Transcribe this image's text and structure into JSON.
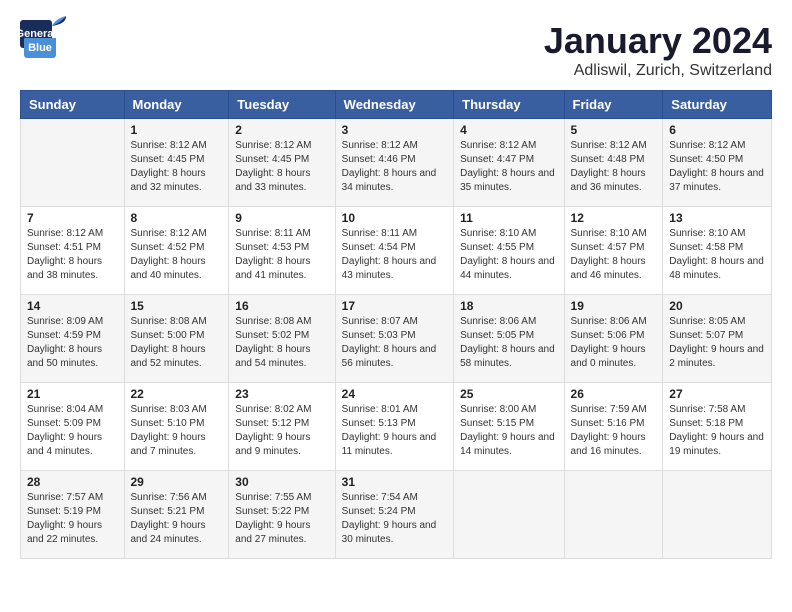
{
  "logo": {
    "general": "General",
    "blue": "Blue"
  },
  "title": "January 2024",
  "location": "Adliswil, Zurich, Switzerland",
  "days_of_week": [
    "Sunday",
    "Monday",
    "Tuesday",
    "Wednesday",
    "Thursday",
    "Friday",
    "Saturday"
  ],
  "weeks": [
    [
      {
        "day": "",
        "sunrise": "",
        "sunset": "",
        "daylight": ""
      },
      {
        "day": "1",
        "sunrise": "Sunrise: 8:12 AM",
        "sunset": "Sunset: 4:45 PM",
        "daylight": "Daylight: 8 hours and 32 minutes."
      },
      {
        "day": "2",
        "sunrise": "Sunrise: 8:12 AM",
        "sunset": "Sunset: 4:45 PM",
        "daylight": "Daylight: 8 hours and 33 minutes."
      },
      {
        "day": "3",
        "sunrise": "Sunrise: 8:12 AM",
        "sunset": "Sunset: 4:46 PM",
        "daylight": "Daylight: 8 hours and 34 minutes."
      },
      {
        "day": "4",
        "sunrise": "Sunrise: 8:12 AM",
        "sunset": "Sunset: 4:47 PM",
        "daylight": "Daylight: 8 hours and 35 minutes."
      },
      {
        "day": "5",
        "sunrise": "Sunrise: 8:12 AM",
        "sunset": "Sunset: 4:48 PM",
        "daylight": "Daylight: 8 hours and 36 minutes."
      },
      {
        "day": "6",
        "sunrise": "Sunrise: 8:12 AM",
        "sunset": "Sunset: 4:50 PM",
        "daylight": "Daylight: 8 hours and 37 minutes."
      }
    ],
    [
      {
        "day": "7",
        "sunrise": "Sunrise: 8:12 AM",
        "sunset": "Sunset: 4:51 PM",
        "daylight": "Daylight: 8 hours and 38 minutes."
      },
      {
        "day": "8",
        "sunrise": "Sunrise: 8:12 AM",
        "sunset": "Sunset: 4:52 PM",
        "daylight": "Daylight: 8 hours and 40 minutes."
      },
      {
        "day": "9",
        "sunrise": "Sunrise: 8:11 AM",
        "sunset": "Sunset: 4:53 PM",
        "daylight": "Daylight: 8 hours and 41 minutes."
      },
      {
        "day": "10",
        "sunrise": "Sunrise: 8:11 AM",
        "sunset": "Sunset: 4:54 PM",
        "daylight": "Daylight: 8 hours and 43 minutes."
      },
      {
        "day": "11",
        "sunrise": "Sunrise: 8:10 AM",
        "sunset": "Sunset: 4:55 PM",
        "daylight": "Daylight: 8 hours and 44 minutes."
      },
      {
        "day": "12",
        "sunrise": "Sunrise: 8:10 AM",
        "sunset": "Sunset: 4:57 PM",
        "daylight": "Daylight: 8 hours and 46 minutes."
      },
      {
        "day": "13",
        "sunrise": "Sunrise: 8:10 AM",
        "sunset": "Sunset: 4:58 PM",
        "daylight": "Daylight: 8 hours and 48 minutes."
      }
    ],
    [
      {
        "day": "14",
        "sunrise": "Sunrise: 8:09 AM",
        "sunset": "Sunset: 4:59 PM",
        "daylight": "Daylight: 8 hours and 50 minutes."
      },
      {
        "day": "15",
        "sunrise": "Sunrise: 8:08 AM",
        "sunset": "Sunset: 5:00 PM",
        "daylight": "Daylight: 8 hours and 52 minutes."
      },
      {
        "day": "16",
        "sunrise": "Sunrise: 8:08 AM",
        "sunset": "Sunset: 5:02 PM",
        "daylight": "Daylight: 8 hours and 54 minutes."
      },
      {
        "day": "17",
        "sunrise": "Sunrise: 8:07 AM",
        "sunset": "Sunset: 5:03 PM",
        "daylight": "Daylight: 8 hours and 56 minutes."
      },
      {
        "day": "18",
        "sunrise": "Sunrise: 8:06 AM",
        "sunset": "Sunset: 5:05 PM",
        "daylight": "Daylight: 8 hours and 58 minutes."
      },
      {
        "day": "19",
        "sunrise": "Sunrise: 8:06 AM",
        "sunset": "Sunset: 5:06 PM",
        "daylight": "Daylight: 9 hours and 0 minutes."
      },
      {
        "day": "20",
        "sunrise": "Sunrise: 8:05 AM",
        "sunset": "Sunset: 5:07 PM",
        "daylight": "Daylight: 9 hours and 2 minutes."
      }
    ],
    [
      {
        "day": "21",
        "sunrise": "Sunrise: 8:04 AM",
        "sunset": "Sunset: 5:09 PM",
        "daylight": "Daylight: 9 hours and 4 minutes."
      },
      {
        "day": "22",
        "sunrise": "Sunrise: 8:03 AM",
        "sunset": "Sunset: 5:10 PM",
        "daylight": "Daylight: 9 hours and 7 minutes."
      },
      {
        "day": "23",
        "sunrise": "Sunrise: 8:02 AM",
        "sunset": "Sunset: 5:12 PM",
        "daylight": "Daylight: 9 hours and 9 minutes."
      },
      {
        "day": "24",
        "sunrise": "Sunrise: 8:01 AM",
        "sunset": "Sunset: 5:13 PM",
        "daylight": "Daylight: 9 hours and 11 minutes."
      },
      {
        "day": "25",
        "sunrise": "Sunrise: 8:00 AM",
        "sunset": "Sunset: 5:15 PM",
        "daylight": "Daylight: 9 hours and 14 minutes."
      },
      {
        "day": "26",
        "sunrise": "Sunrise: 7:59 AM",
        "sunset": "Sunset: 5:16 PM",
        "daylight": "Daylight: 9 hours and 16 minutes."
      },
      {
        "day": "27",
        "sunrise": "Sunrise: 7:58 AM",
        "sunset": "Sunset: 5:18 PM",
        "daylight": "Daylight: 9 hours and 19 minutes."
      }
    ],
    [
      {
        "day": "28",
        "sunrise": "Sunrise: 7:57 AM",
        "sunset": "Sunset: 5:19 PM",
        "daylight": "Daylight: 9 hours and 22 minutes."
      },
      {
        "day": "29",
        "sunrise": "Sunrise: 7:56 AM",
        "sunset": "Sunset: 5:21 PM",
        "daylight": "Daylight: 9 hours and 24 minutes."
      },
      {
        "day": "30",
        "sunrise": "Sunrise: 7:55 AM",
        "sunset": "Sunset: 5:22 PM",
        "daylight": "Daylight: 9 hours and 27 minutes."
      },
      {
        "day": "31",
        "sunrise": "Sunrise: 7:54 AM",
        "sunset": "Sunset: 5:24 PM",
        "daylight": "Daylight: 9 hours and 30 minutes."
      },
      {
        "day": "",
        "sunrise": "",
        "sunset": "",
        "daylight": ""
      },
      {
        "day": "",
        "sunrise": "",
        "sunset": "",
        "daylight": ""
      },
      {
        "day": "",
        "sunrise": "",
        "sunset": "",
        "daylight": ""
      }
    ]
  ]
}
